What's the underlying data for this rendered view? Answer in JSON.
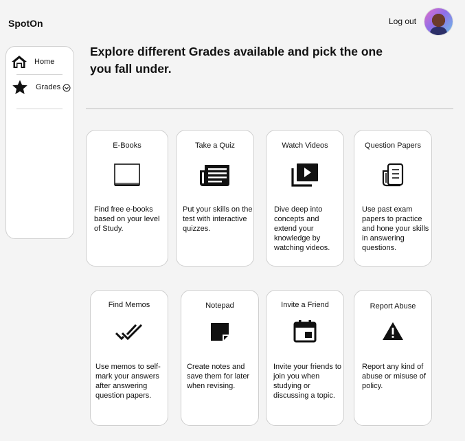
{
  "app": {
    "brand": "SpotOn"
  },
  "header": {
    "logout_label": "Log out"
  },
  "sidebar": {
    "items": [
      {
        "label": "Home",
        "icon": "home-icon"
      },
      {
        "label": "Grades",
        "icon": "star-icon"
      }
    ]
  },
  "main": {
    "heading": "Explore different Grades available and pick the one you fall under.",
    "cards": [
      {
        "title": "E-Books",
        "icon": "book-icon",
        "desc": "Find free e-books based on your level of Study."
      },
      {
        "title": "Take a Quiz",
        "icon": "article-icon",
        "desc": "Put your skills on the test with interactive quizzes."
      },
      {
        "title": "Watch Videos",
        "icon": "video-library-icon",
        "desc": "Dive deep into concepts and extend your knowledge by watching videos."
      },
      {
        "title": "Question Papers",
        "icon": "newspaper-icon",
        "desc": "Use past exam papers to practice and hone your skills in answering questions."
      },
      {
        "title": "Find Memos",
        "icon": "double-check-icon",
        "desc": "Use memos to self-mark your answers after answering question papers."
      },
      {
        "title": "Notepad",
        "icon": "note-icon",
        "desc": "Create notes and save them for later when revising."
      },
      {
        "title": "Invite a Friend",
        "icon": "calendar-icon",
        "desc": "Invite your friends to join you when studying or discussing a topic."
      },
      {
        "title": "Report Abuse",
        "icon": "warning-icon",
        "desc": "Report any kind of abuse or misuse of policy."
      }
    ]
  }
}
